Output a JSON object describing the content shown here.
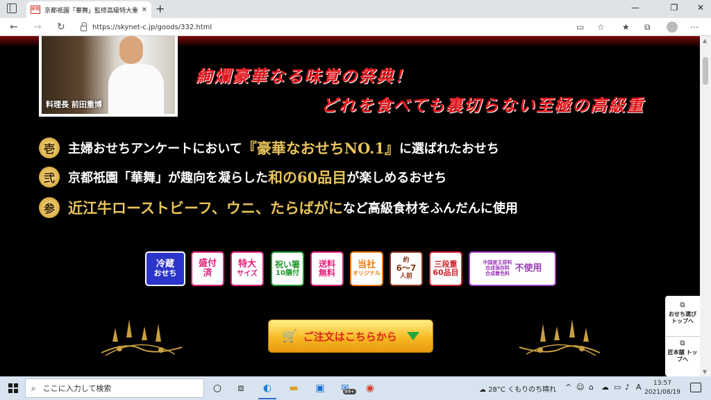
{
  "browser": {
    "tab_title": "京都祇園「華舞」監修高級特大重",
    "favicon_text": "華舞",
    "url": "https://skynet-c.jp/goods/332.html"
  },
  "hero": {
    "chef_caption": "料理長 前田重博",
    "headline_line1": "絢爛豪華なる味覚の祭典！",
    "headline_line2": "どれを食べても裏切らない至極の高級重"
  },
  "features": [
    {
      "badge": "壱",
      "before": "主婦おせちアンケートにおいて",
      "highlight": "『豪華なおせちNO.1』",
      "after": "に選ばれたおせち"
    },
    {
      "badge": "弐",
      "before": "京都祇園「華舞」が趣向を凝らした",
      "highlight": "和の60品目",
      "after": "が楽しめるおせち"
    },
    {
      "badge": "参",
      "before": "",
      "highlight": "近江牛ローストビーフ、ウニ、たらばがに",
      "after": "など高級食材をふんだんに使用"
    }
  ],
  "chips": [
    {
      "lines": [
        "冷蔵",
        "おせち"
      ],
      "color": "#2c35c9",
      "filled": true
    },
    {
      "lines": [
        "盛付",
        "済"
      ],
      "color": "#e0207a"
    },
    {
      "lines": [
        "特大",
        "サイズ"
      ],
      "color": "#e0207a"
    },
    {
      "lines": [
        "祝い箸",
        "10膳付"
      ],
      "color": "#1f9a2c"
    },
    {
      "lines": [
        "送料",
        "無料"
      ],
      "color": "#e0207a"
    },
    {
      "lines": [
        "当社",
        "オリジナル"
      ],
      "color": "#f07a10"
    },
    {
      "lines": [
        "約",
        "6～7",
        "人前"
      ],
      "color": "#8a3a1a"
    },
    {
      "lines": [
        "三段重",
        "60品目"
      ],
      "color": "#d0202a"
    },
    {
      "lines": [
        "中国産主原料",
        "合成保存料",
        "合成着色料"
      ],
      "tail": "不使用",
      "color": "#9b3bb8"
    }
  ],
  "order_button": {
    "label": "ご注文はこちらから"
  },
  "side_panel": {
    "link1": "おせち選び トップへ",
    "link2": "匠本舗 トップへ"
  },
  "taskbar": {
    "search_placeholder": "ここに入力して検索",
    "mail_badge": "99+",
    "weather": "28°C くもりのち晴れ",
    "ime": "A",
    "time": "13:57",
    "date": "2021/08/19"
  }
}
